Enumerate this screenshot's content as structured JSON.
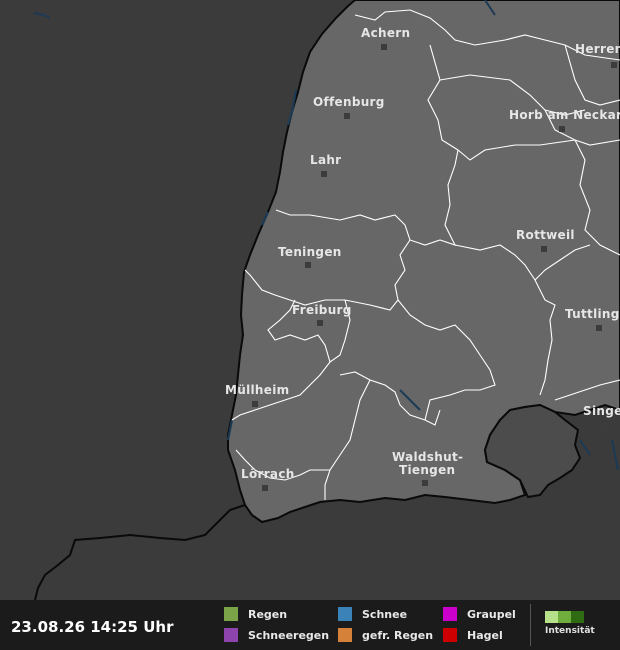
{
  "cities": [
    {
      "name": "Achern",
      "label": "Achern"
    },
    {
      "name": "Herrenberg",
      "label": "Herren"
    },
    {
      "name": "Offenburg",
      "label": "Offenburg"
    },
    {
      "name": "Horb am Neckar",
      "label": "Horb am Neckar"
    },
    {
      "name": "Lahr",
      "label": "Lahr"
    },
    {
      "name": "Rottweil",
      "label": "Rottweil"
    },
    {
      "name": "Teningen",
      "label": "Teningen"
    },
    {
      "name": "Freiburg",
      "label": "Freiburg"
    },
    {
      "name": "Tuttlingen",
      "label": "Tuttlinge"
    },
    {
      "name": "Müllheim",
      "label": "Müllheim"
    },
    {
      "name": "Singen",
      "label": "Singe"
    },
    {
      "name": "Waldshut-Tiengen",
      "label_line1": "Waldshut-",
      "label_line2": "Tiengen"
    },
    {
      "name": "Lörrach",
      "label": "Lörrach"
    }
  ],
  "footer": {
    "timestamp": "23.08.26 14:25 Uhr",
    "legend": [
      {
        "label": "Regen",
        "color": "#7aa447"
      },
      {
        "label": "Schneeregen",
        "color": "#8e44ad"
      },
      {
        "label": "Schnee",
        "color": "#3b82b8"
      },
      {
        "label": "gefr. Regen",
        "color": "#d6813a"
      },
      {
        "label": "Graupel",
        "color": "#cc00cc"
      },
      {
        "label": "Hagel",
        "color": "#cc0000"
      }
    ],
    "intensity_label": "Intensität",
    "intensity_colors": [
      "#b6e08a",
      "#6fae3d",
      "#2f6b12"
    ]
  },
  "colors": {
    "land": "#676767",
    "outside": "#3b3b3b",
    "switzerland": "#4c4c4c",
    "border": "#0a0a0a",
    "district_line": "#ffffff",
    "water": "#1d3a55"
  }
}
